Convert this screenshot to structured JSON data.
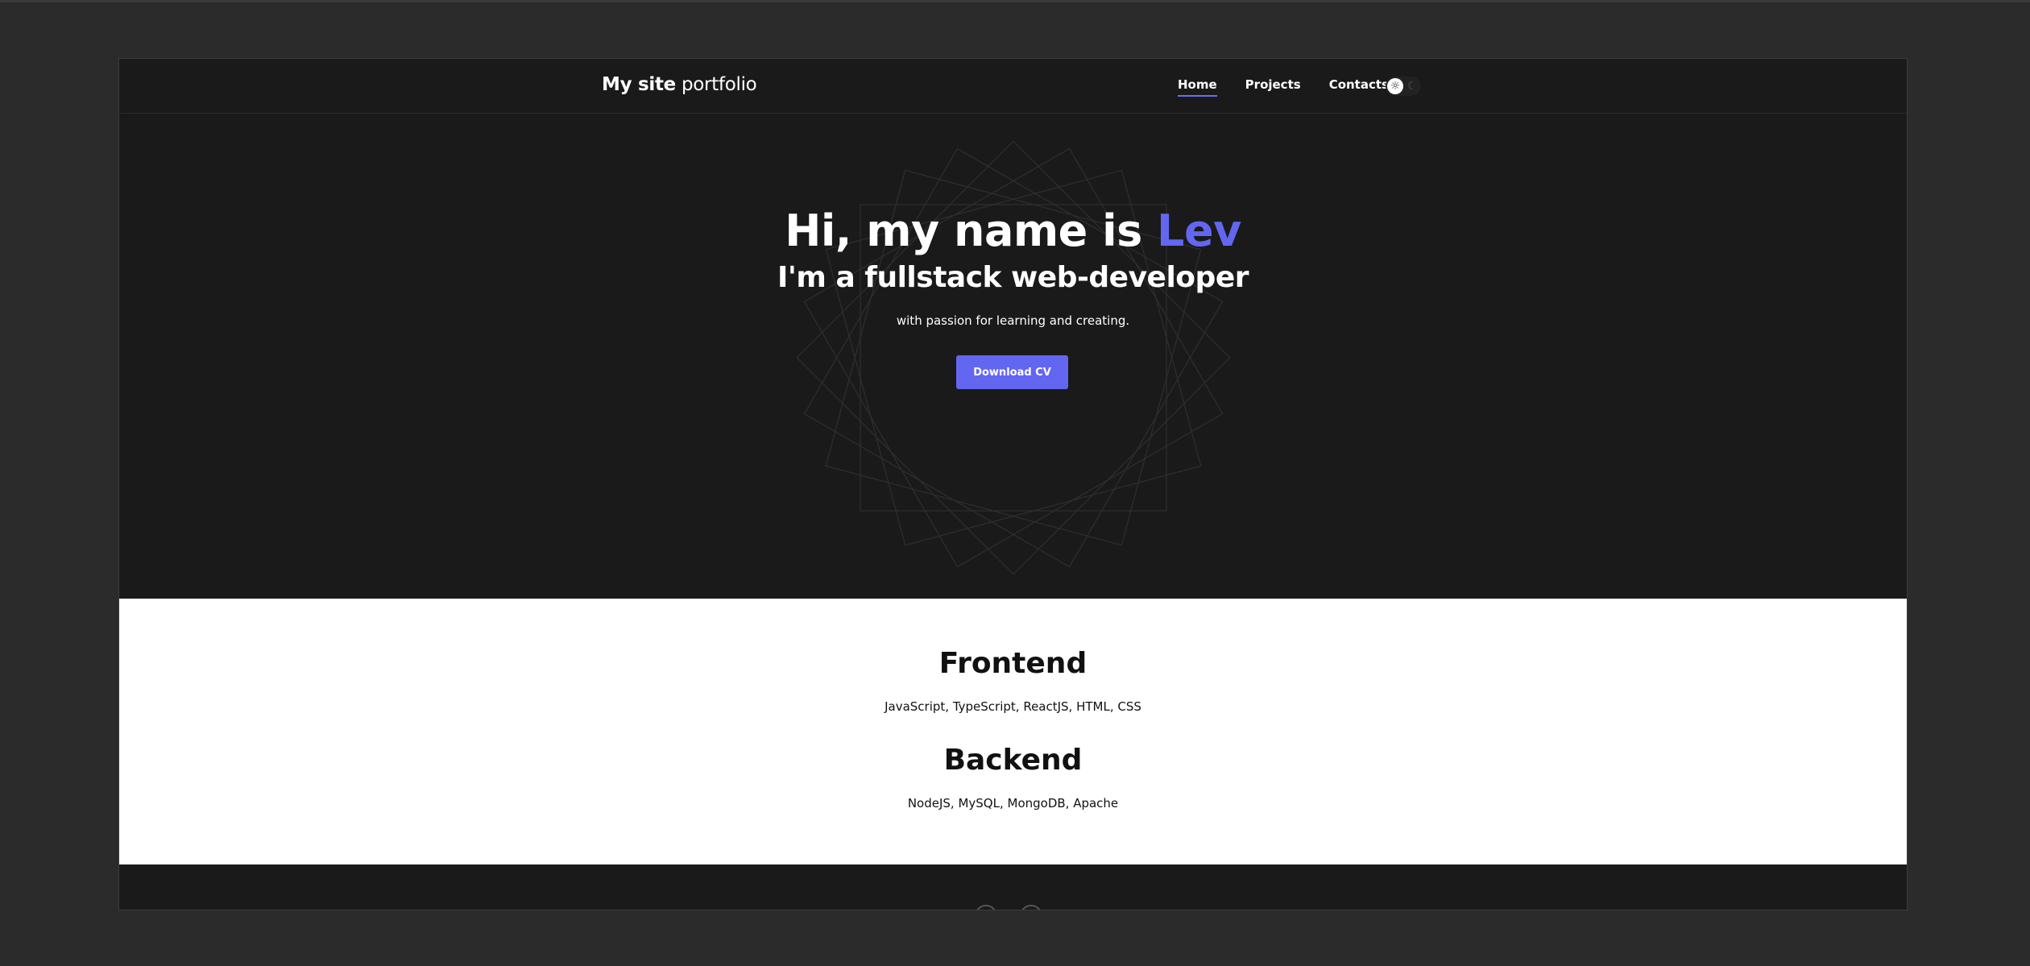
{
  "header": {
    "logo_bold": "My site",
    "logo_light": "portfolio",
    "nav": [
      {
        "label": "Home",
        "active": true
      },
      {
        "label": "Projects",
        "active": false
      },
      {
        "label": "Contacts",
        "active": false
      }
    ],
    "theme_toggle": {
      "sun_icon": "sun-icon",
      "moon_icon": "moon-icon",
      "state": "light-knob"
    }
  },
  "hero": {
    "title_prefix": "Hi, my name is ",
    "title_name": "Lev",
    "subtitle": "I'm a fullstack web-developer",
    "tagline": "with passion for learning and creating.",
    "cta_label": "Download CV"
  },
  "skills": {
    "frontend_title": "Frontend",
    "frontend_list": "JavaScript, TypeScript, ReactJS, HTML, CSS",
    "backend_title": "Backend",
    "backend_list": "NodeJS, MySQL, MongoDB, Apache"
  },
  "colors": {
    "accent": "#6366f1",
    "background_dark": "#1a1a1a",
    "page_outer": "#2b2b2b",
    "skills_bg": "#ffffff"
  }
}
